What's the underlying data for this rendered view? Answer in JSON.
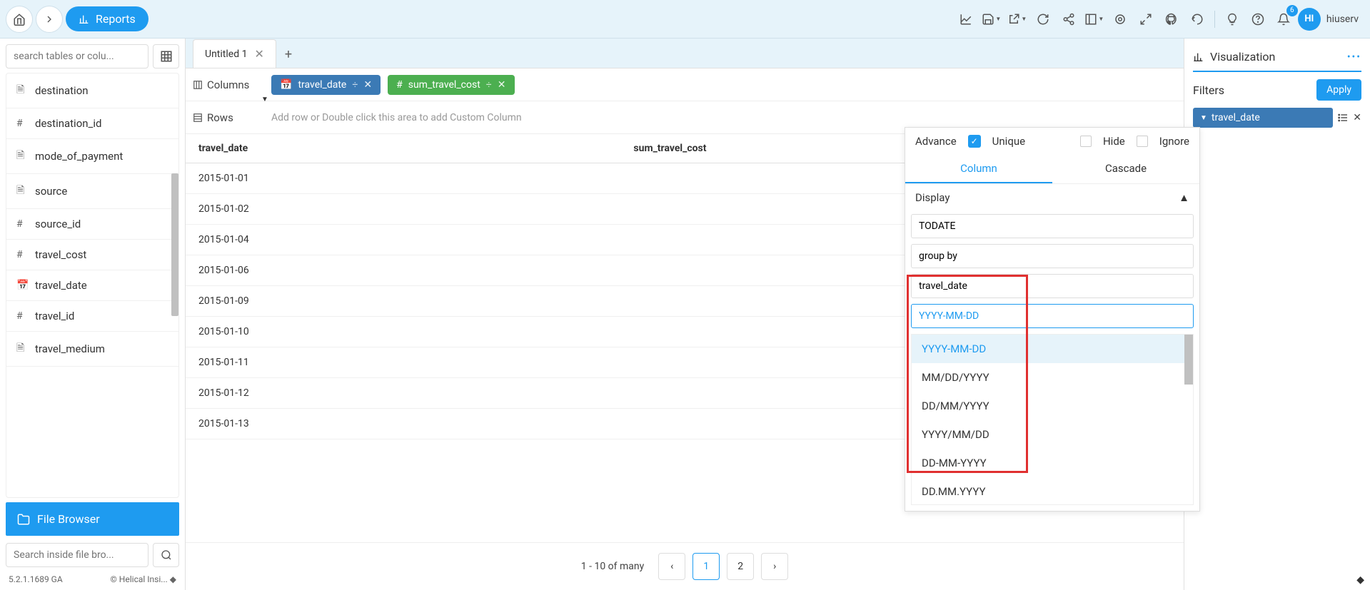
{
  "topbar": {
    "reports_label": "Reports",
    "notif_count": "6",
    "avatar_initials": "HI",
    "username": "hiuserv"
  },
  "sidebar": {
    "search_placeholder": "search tables or colu...",
    "fields": [
      {
        "icon": "file",
        "label": "destination"
      },
      {
        "icon": "hash",
        "label": "destination_id"
      },
      {
        "icon": "file",
        "label": "mode_of_payment"
      },
      {
        "icon": "file",
        "label": "source"
      },
      {
        "icon": "hash",
        "label": "source_id"
      },
      {
        "icon": "hash",
        "label": "travel_cost"
      },
      {
        "icon": "date",
        "label": "travel_date"
      },
      {
        "icon": "hash",
        "label": "travel_id"
      },
      {
        "icon": "file",
        "label": "travel_medium"
      }
    ],
    "file_browser_label": "File Browser",
    "file_search_placeholder": "Search inside file bro...",
    "version": "5.2.1.1689 GA",
    "copyright": "© Helical Insi..."
  },
  "tabs": {
    "tab1": "Untitled 1"
  },
  "config": {
    "columns_label": "Columns",
    "rows_label": "Rows",
    "pill1_label": "travel_date",
    "pill2_label": "sum_travel_cost",
    "rows_placeholder": "Add row or Double click this area to add Custom Column"
  },
  "table": {
    "headers": [
      "travel_date",
      "sum_travel_cost"
    ],
    "rows": [
      "2015-01-01",
      "2015-01-02",
      "2015-01-04",
      "2015-01-06",
      "2015-01-09",
      "2015-01-10",
      "2015-01-11",
      "2015-01-12",
      "2015-01-13"
    ]
  },
  "pagination": {
    "info": "1 - 10 of many",
    "page1": "1",
    "page2": "2"
  },
  "rightpanel": {
    "viz_label": "Visualization",
    "filters_label": "Filters",
    "apply_label": "Apply",
    "filter_chip": "travel_date"
  },
  "popup": {
    "advance_label": "Advance",
    "unique_label": "Unique",
    "hide_label": "Hide",
    "ignore_label": "Ignore",
    "tab_column": "Column",
    "tab_cascade": "Cascade",
    "display_label": "Display",
    "field_todate": "TODATE",
    "field_groupby": "group by",
    "field_travel_date": "travel_date",
    "format_input_value": "YYYY-MM-DD",
    "options": [
      "YYYY-MM-DD",
      "MM/DD/YYYY",
      "DD/MM/YYYY",
      "YYYY/MM/DD",
      "DD-MM-YYYY",
      "DD.MM.YYYY"
    ]
  }
}
